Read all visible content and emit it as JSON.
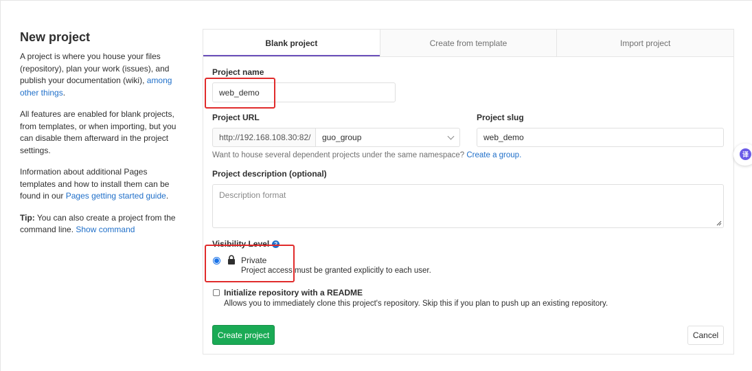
{
  "sidebar": {
    "title": "New project",
    "para1_text": "A project is where you house your files (repository), plan your work (issues), and publish your documentation (wiki), ",
    "para1_link": "among other things",
    "para1_end": ".",
    "para2": "All features are enabled for blank projects, from templates, or when importing, but you can disable them afterward in the project settings.",
    "para3_text": "Information about additional Pages templates and how to install them can be found in our ",
    "para3_link": "Pages getting started guide",
    "para3_end": ".",
    "tip_label": "Tip:",
    "tip_text": " You can also create a project from the command line. ",
    "tip_link": "Show command"
  },
  "tabs": [
    "Blank project",
    "Create from template",
    "Import project"
  ],
  "form": {
    "project_name_label": "Project name",
    "project_name_value": "web_demo",
    "project_url_label": "Project URL",
    "url_prefix": "http://192.168.108.30:82/",
    "namespace_value": "guo_group",
    "project_slug_label": "Project slug",
    "project_slug_value": "web_demo",
    "namespace_help_text": "Want to house several dependent projects under the same namespace? ",
    "namespace_help_link": "Create a group.",
    "description_label": "Project description (optional)",
    "description_placeholder": "Description format",
    "visibility_label": "Visibility Level",
    "visibility_help_icon": "?",
    "private_label": "Private",
    "private_desc": "Project access must be granted explicitly to each user.",
    "readme_label": "Initialize repository with a README",
    "readme_desc": "Allows you to immediately clone this project's repository. Skip this if you plan to push up an existing repository.",
    "create_button": "Create project",
    "cancel_button": "Cancel"
  },
  "colors": {
    "accent": "#1aaa55",
    "link": "#1f6fc9",
    "highlight": "#e02a2a",
    "tab_active": "#6b4fbb"
  },
  "float_widget_icon": "译"
}
